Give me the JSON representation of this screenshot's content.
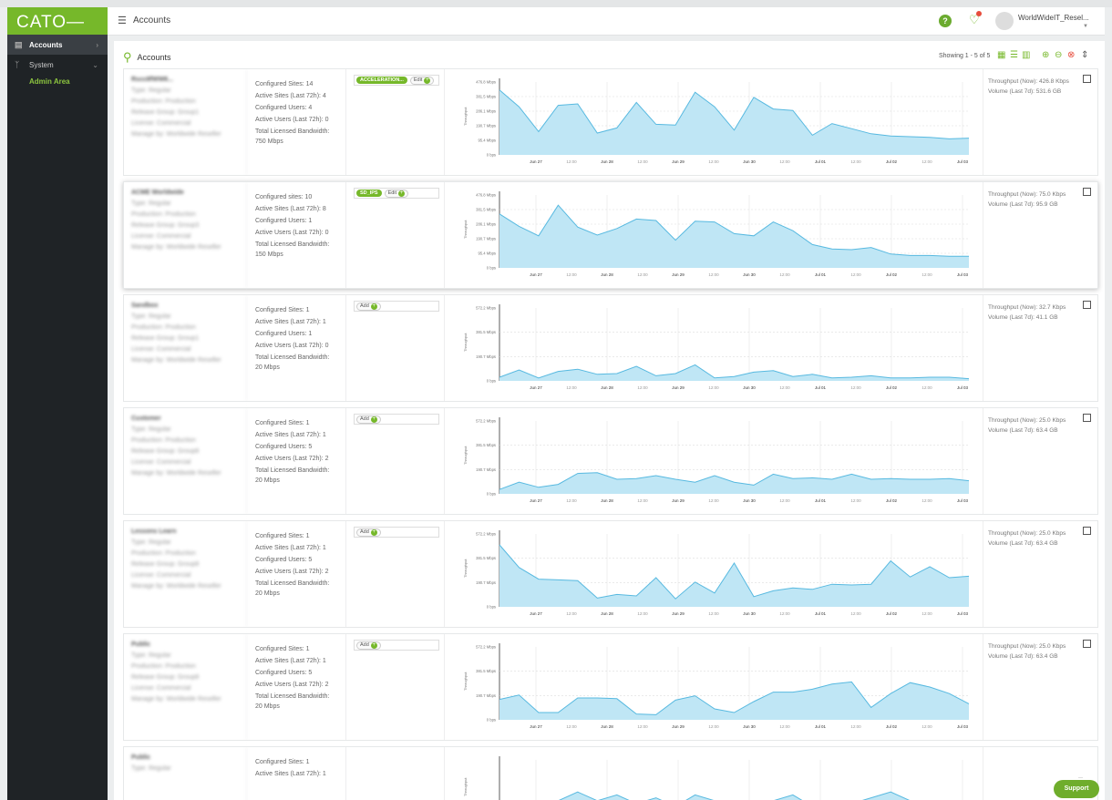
{
  "app": {
    "logo": "CATO",
    "page_title": "Accounts",
    "user_name": "WorldWideIT_Resel..."
  },
  "sidebar": {
    "items": [
      {
        "label": "Accounts",
        "icon": "database-icon",
        "active": true
      },
      {
        "label": "System",
        "icon": "plug-icon",
        "active": false
      }
    ],
    "sub_label": "Admin Area"
  },
  "panel": {
    "title": "Accounts",
    "showing": "Showing 1 - 5 of 5"
  },
  "support_label": "Support",
  "accounts": [
    {
      "blur_lines": [
        "Rscc8fWW8...",
        "Type: Regular",
        "Production: Production",
        "Release Group: Group1",
        "License: Commercial",
        "Manage by: Worldwide Reseller"
      ],
      "stats": [
        "Configured Sites: 14",
        "Active Sites (Last 72h): 4",
        "Configured Users: 4",
        "Active Users (Last 72h): 0",
        "Total Licensed Bandwidth:",
        "750 Mbps"
      ],
      "tags": [
        "ACCELERATION..."
      ],
      "action": "Edit",
      "throughput": "Throughput (Now): 426.8 Kbps",
      "volume": "Volume (Last 7d): 531.6 GB",
      "ylabels": [
        "476.8 Mbps",
        "381.5 Mbps",
        "286.1 Mbps",
        "190.7 Mbps",
        "95.4 Mbps",
        "0 bps"
      ],
      "values": [
        0.89,
        0.66,
        0.32,
        0.68,
        0.7,
        0.3,
        0.37,
        0.72,
        0.42,
        0.41,
        0.86,
        0.66,
        0.34,
        0.79,
        0.63,
        0.61,
        0.27,
        0.43,
        0.36,
        0.29,
        0.26,
        0.25,
        0.24,
        0.22,
        0.23
      ],
      "highlight": false
    },
    {
      "blur_lines": [
        "ACME Worldwide",
        "Type: Regular",
        "Production: Production",
        "Release Group: Group3",
        "License: Commercial",
        "Manage by: Worldwide Reseller"
      ],
      "stats": [
        "Configured sites: 10",
        "Active Sites (Last 72h): 8",
        "Configured Users: 1",
        "Active Users (Last 72h): 0",
        "Total Licensed Bandwidth:",
        "150 Mbps"
      ],
      "tags": [
        "SD_IPS"
      ],
      "action": "Edit",
      "throughput": "Throughput (Now): 75.0 Kbps",
      "volume": "Volume (Last 7d): 95.9 GB",
      "ylabels": [
        "476.8 Mbps",
        "381.5 Mbps",
        "286.1 Mbps",
        "190.7 Mbps",
        "95.4 Mbps",
        "0 bps"
      ],
      "values": [
        0.74,
        0.57,
        0.44,
        0.86,
        0.56,
        0.45,
        0.54,
        0.67,
        0.65,
        0.38,
        0.64,
        0.63,
        0.47,
        0.44,
        0.63,
        0.51,
        0.32,
        0.26,
        0.25,
        0.28,
        0.19,
        0.17,
        0.17,
        0.16,
        0.16
      ],
      "highlight": true
    },
    {
      "blur_lines": [
        "Sandbox",
        "Type: Regular",
        "Production: Production",
        "Release Group: Group1",
        "License: Commercial",
        "Manage by: Worldwide Reseller"
      ],
      "stats": [
        "Configured Sites: 1",
        "Active Sites (Last 72h): 1",
        "Configured Users: 1",
        "Active Users (Last 72h): 0",
        "Total Licensed Bandwidth:",
        "20 Mbps"
      ],
      "tags": [],
      "action": "Add",
      "throughput": "Throughput (Now): 32.7 Kbps",
      "volume": "Volume (Last 7d): 41.1 GB",
      "ylabels": [
        "572.2 Mbps",
        "381.5 Mbps",
        "190.7 Mbps",
        "0 bps"
      ],
      "values": [
        0.05,
        0.15,
        0.04,
        0.13,
        0.16,
        0.09,
        0.1,
        0.2,
        0.07,
        0.1,
        0.22,
        0.04,
        0.06,
        0.12,
        0.14,
        0.06,
        0.09,
        0.04,
        0.05,
        0.07,
        0.04,
        0.04,
        0.05,
        0.05,
        0.03
      ],
      "highlight": false
    },
    {
      "blur_lines": [
        "Customer",
        "Type: Regular",
        "Production: Production",
        "Release Group: Group8",
        "License: Commercial",
        "Manage by: Worldwide Reseller"
      ],
      "stats": [
        "Configured Sites: 1",
        "Active Sites (Last 72h): 1",
        "Configured Users: 5",
        "Active Users (Last 72h): 2",
        "Total Licensed Bandwidth:",
        "20 Mbps"
      ],
      "tags": [],
      "action": "Add",
      "throughput": "Throughput (Now): 25.0 Kbps",
      "volume": "Volume (Last 7d): 63.4 GB",
      "ylabels": [
        "572.2 Mbps",
        "381.5 Mbps",
        "190.7 Mbps",
        "0 bps"
      ],
      "values": [
        0.06,
        0.16,
        0.09,
        0.13,
        0.28,
        0.29,
        0.2,
        0.21,
        0.25,
        0.2,
        0.16,
        0.25,
        0.16,
        0.12,
        0.27,
        0.21,
        0.22,
        0.2,
        0.27,
        0.2,
        0.21,
        0.2,
        0.2,
        0.21,
        0.18
      ],
      "highlight": false
    },
    {
      "blur_lines": [
        "Lessons Learn",
        "Type: Regular",
        "Production: Production",
        "Release Group: Group8",
        "License: Commercial",
        "Manage by: Worldwide Reseller"
      ],
      "stats": [
        "Configured Sites: 1",
        "Active Sites (Last 72h): 1",
        "Configured Users: 5",
        "Active Users (Last 72h): 2",
        "Total Licensed Bandwidth:",
        "20 Mbps"
      ],
      "tags": [],
      "action": "Add",
      "throughput": "Throughput (Now): 25.0 Kbps",
      "volume": "Volume (Last 7d): 63.4 GB",
      "ylabels": [
        "572.2 Mbps",
        "381.5 Mbps",
        "190.7 Mbps",
        "0 bps"
      ],
      "values": [
        0.85,
        0.54,
        0.38,
        0.37,
        0.36,
        0.12,
        0.17,
        0.15,
        0.4,
        0.11,
        0.34,
        0.19,
        0.6,
        0.14,
        0.22,
        0.26,
        0.24,
        0.31,
        0.3,
        0.31,
        0.63,
        0.41,
        0.55,
        0.4,
        0.42
      ],
      "highlight": false
    },
    {
      "blur_lines": [
        "Public",
        "Type: Regular",
        "Production: Production",
        "Release Group: Group8",
        "License: Commercial",
        "Manage by: Worldwide Reseller"
      ],
      "stats": [
        "Configured Sites: 1",
        "Active Sites (Last 72h): 1",
        "Configured Users: 5",
        "Active Users (Last 72h): 2",
        "Total Licensed Bandwidth:",
        "20 Mbps"
      ],
      "tags": [],
      "action": "Add",
      "throughput": "Throughput (Now): 25.0 Kbps",
      "volume": "Volume (Last 7d): 63.4 GB",
      "ylabels": [
        "572.2 Mbps",
        "381.5 Mbps",
        "190.7 Mbps",
        "0 bps"
      ],
      "values": [
        0.28,
        0.34,
        0.1,
        0.1,
        0.3,
        0.3,
        0.29,
        0.08,
        0.07,
        0.27,
        0.33,
        0.15,
        0.1,
        0.25,
        0.38,
        0.38,
        0.42,
        0.49,
        0.52,
        0.17,
        0.36,
        0.51,
        0.45,
        0.36,
        0.22
      ],
      "highlight": false
    },
    {
      "blur_lines": [
        "Public",
        "Type: Regular"
      ],
      "stats": [
        "Configured Sites: 1",
        "Active Sites (Last 72h): 1"
      ],
      "tags": [],
      "action": "",
      "throughput": "",
      "volume": "",
      "ylabels": [
        "190.7 Mbps"
      ],
      "values": [
        0.05,
        0.1,
        0.12,
        0.3,
        0.45,
        0.3,
        0.4,
        0.25,
        0.35,
        0.2,
        0.4,
        0.3,
        0.2,
        0.25,
        0.3,
        0.4,
        0.2,
        0.3,
        0.25,
        0.35,
        0.45,
        0.3,
        0.2,
        0.25,
        0.2
      ],
      "highlight": false
    }
  ],
  "xlabels": [
    "Jun 27",
    "12:00",
    "Jun 28",
    "12:00",
    "Jun 29",
    "12:00",
    "Jun 30",
    "12:00",
    "Jul 01",
    "12:00",
    "Jul 02",
    "12:00",
    "Jul 03"
  ],
  "colors": {
    "brand": "#76b82a",
    "chart_fill": "#bfe6f5",
    "chart_line": "#57b9e0"
  }
}
